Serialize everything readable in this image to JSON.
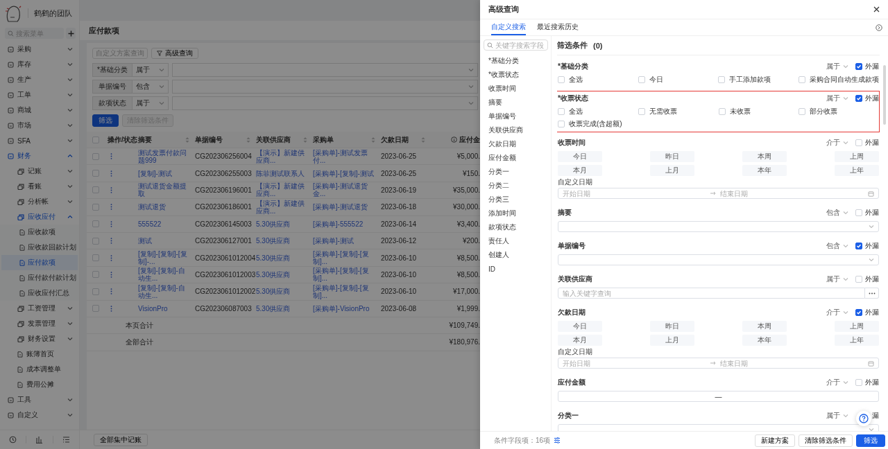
{
  "sidebar": {
    "team_name": "鹤鹤的团队",
    "search": {
      "placeholder": "搜索菜单"
    },
    "menu": [
      {
        "label": "采购",
        "expanded": false,
        "selected": false
      },
      {
        "label": "库存",
        "expanded": false,
        "selected": false
      },
      {
        "label": "生产",
        "expanded": false,
        "selected": false
      },
      {
        "label": "工单",
        "expanded": false,
        "selected": false
      },
      {
        "label": "商城",
        "expanded": false,
        "selected": false
      },
      {
        "label": "市场",
        "expanded": false,
        "selected": false
      },
      {
        "label": "SFA",
        "expanded": false,
        "selected": false
      },
      {
        "label": "财务",
        "expanded": true,
        "selected": false,
        "children": [
          {
            "label": "记账",
            "expanded": false,
            "selected": false
          },
          {
            "label": "看账",
            "expanded": false,
            "selected": false
          },
          {
            "label": "分析帐",
            "expanded": false,
            "selected": false
          },
          {
            "label": "应收应付",
            "expanded": true,
            "selected": false,
            "children": [
              {
                "label": "应收款项",
                "selected": false
              },
              {
                "label": "应收款回款计划",
                "selected": false
              },
              {
                "label": "应付款项",
                "selected": true
              },
              {
                "label": "应付款付款计划",
                "selected": false
              },
              {
                "label": "应收应付汇总",
                "selected": false
              }
            ]
          },
          {
            "label": "工资管理",
            "expanded": false,
            "selected": false
          },
          {
            "label": "发票管理",
            "expanded": false,
            "selected": false
          },
          {
            "label": "财务设置",
            "expanded": false,
            "selected": false
          },
          {
            "label": "账簿首页",
            "selected": false
          },
          {
            "label": "成本调整单",
            "selected": false
          },
          {
            "label": "费用公摊",
            "selected": false
          }
        ]
      },
      {
        "label": "工具",
        "expanded": false,
        "selected": false
      },
      {
        "label": "自定义",
        "expanded": false,
        "selected": false
      }
    ]
  },
  "page": {
    "title": "应付款项",
    "scheme_select": {
      "placeholder": "自定义方案查询"
    },
    "advanced_button": "高级查询",
    "filters": [
      {
        "label": "*基础分类",
        "operator": "属于"
      },
      {
        "label": "单据编号",
        "operator": "包含"
      },
      {
        "label": "款项状态",
        "operator": "属于"
      }
    ],
    "filter_button": "筛选",
    "clear_button": {
      "label": "清除筛选条件",
      "disabled": true
    },
    "table": {
      "all_selected": false,
      "columns": [
        {
          "label": "操作/状态"
        },
        {
          "label": "摘要",
          "sortable": true
        },
        {
          "label": "单据编号",
          "sortable": true
        },
        {
          "label": "关联供应商",
          "sortable": true
        },
        {
          "label": "采购单",
          "sortable": true
        },
        {
          "label": "欠款日期",
          "sortable": true
        },
        {
          "label": "应付金"
        }
      ],
      "rows": [
        {
          "selected": false,
          "summary": "测试发票付款问题999",
          "number": "CG202306256004",
          "supplier": "【演示】新建供应商...",
          "order": "[采购单]-测试发票付...",
          "date": "2023-06-25",
          "amount": "¥5,000."
        },
        {
          "selected": false,
          "summary": "[复制]-测试",
          "number": "CG202306255003",
          "supplier": "陈菲测试联系人",
          "order": "[采购单]-[复制]-测试",
          "date": "2023-06-25",
          "amount": "¥150."
        },
        {
          "selected": false,
          "summary": "测试退货金额提取",
          "number": "CG202306196001",
          "supplier": "【演示】新建供应商...",
          "order": "[采购单]-测试退货金...",
          "date": "2023-06-19",
          "amount": "¥35,000."
        },
        {
          "selected": false,
          "summary": "测试退货",
          "number": "CG202306186001",
          "supplier": "【演示】新建供应商...",
          "order": "[采购单]-测试退货",
          "date": "2023-06-18",
          "amount": "¥30,000."
        },
        {
          "selected": false,
          "summary": "555522",
          "number": "CG202306145003",
          "supplier": "5.30供应商",
          "order": "[采购单]-555522",
          "date": "2023-06-14",
          "amount": "¥3,400."
        },
        {
          "selected": false,
          "summary": "测试",
          "number": "CG202306127001",
          "supplier": "5.30供应商",
          "order": "[采购单]-测试",
          "date": "2023-06-12",
          "amount": "¥200."
        },
        {
          "selected": false,
          "summary": "[复制]-[复制]-[复制]-...",
          "number": "CG2023061012004",
          "supplier": "5.30供应商",
          "order": "[采购单]-[复制]-[复制]...",
          "date": "2023-06-10",
          "amount": "¥8,500."
        },
        {
          "selected": false,
          "summary": "[复制]-[复制]-自动生...",
          "number": "CG2023061012003",
          "supplier": "5.30供应商",
          "order": "[采购单]-[复制]-[复制]...",
          "date": "2023-06-10",
          "amount": "¥8,500."
        },
        {
          "selected": false,
          "summary": "[复制]-[复制]-自动生...",
          "number": "CG2023061012002",
          "supplier": "5.30供应商",
          "order": "[采购单]-[复制]-[复制]...",
          "date": "2023-06-10",
          "amount": "¥17,000."
        },
        {
          "selected": false,
          "summary": "VisionPro",
          "number": "CG202306087003",
          "supplier": "5.30供应商",
          "order": "[采购单]-VisionPro",
          "date": "2023-06-08",
          "amount": "¥1,999."
        }
      ],
      "totals": [
        {
          "label": "本页合计",
          "amount": "¥109,749."
        },
        {
          "label": "全部合计",
          "amount": "¥180,976."
        }
      ]
    },
    "bulk_button": "全部集中记账"
  },
  "drawer": {
    "title": "高级查询",
    "tabs": [
      {
        "label": "自定义搜索",
        "selected": true
      },
      {
        "label": "最近搜索历史",
        "selected": false
      }
    ],
    "field_search": {
      "placeholder": "关键字搜索字段"
    },
    "fields": [
      "*基础分类",
      "*收票状态",
      "收票时间",
      "摘要",
      "单据编号",
      "关联供应商",
      "欠款日期",
      "应付金额",
      "分类一",
      "分类二",
      "分类三",
      "添加时间",
      "款项状态",
      "责任人",
      "创建人",
      "ID"
    ],
    "conditions_title": "筛选条件",
    "conditions_count": "(0)",
    "sections": [
      {
        "label": "*基础分类",
        "operator": "属于",
        "outside": {
          "label": "外漏",
          "checked": true
        },
        "highlighted": false,
        "kind": "checkboxes",
        "options": [
          {
            "label": "全选",
            "checked": false
          },
          {
            "label": "今日",
            "checked": false
          },
          {
            "label": "手工添加款项",
            "checked": false
          },
          {
            "label": "采购合同自动生成款项",
            "checked": false
          }
        ]
      },
      {
        "label": "*收票状态",
        "operator": "属于",
        "outside": {
          "label": "外漏",
          "checked": true
        },
        "highlighted": true,
        "kind": "checkboxes",
        "options": [
          {
            "label": "全选",
            "checked": false
          },
          {
            "label": "无需收票",
            "checked": false
          },
          {
            "label": "未收票",
            "checked": false
          },
          {
            "label": "部分收票",
            "checked": false
          },
          {
            "label": "收票完成(含超额)",
            "checked": false
          }
        ]
      },
      {
        "label": "收票时间",
        "operator": "介于",
        "outside": {
          "label": "外漏",
          "checked": false
        },
        "highlighted": false,
        "kind": "dates",
        "presets": [
          "今日",
          "昨日",
          "本周",
          "上周",
          "本月",
          "上月",
          "本年",
          "上年"
        ],
        "custom_label": "自定义日期",
        "start_placeholder": "开始日期",
        "end_placeholder": "结束日期"
      },
      {
        "label": "摘要",
        "operator": "包含",
        "outside": {
          "label": "外漏",
          "checked": false
        },
        "highlighted": false,
        "kind": "select"
      },
      {
        "label": "单据编号",
        "operator": "包含",
        "outside": {
          "label": "外漏",
          "checked": true
        },
        "highlighted": false,
        "kind": "select"
      },
      {
        "label": "关联供应商",
        "operator": "属于",
        "outside": {
          "label": "外漏",
          "checked": false
        },
        "highlighted": false,
        "kind": "lookup",
        "placeholder": "输入关键字查询"
      },
      {
        "label": "欠款日期",
        "operator": "介于",
        "outside": {
          "label": "外漏",
          "checked": true
        },
        "highlighted": false,
        "kind": "dates",
        "presets": [
          "今日",
          "昨日",
          "本周",
          "上周",
          "本月",
          "上月",
          "本年",
          "上年"
        ],
        "custom_label": "自定义日期",
        "start_placeholder": "开始日期",
        "end_placeholder": "结束日期"
      },
      {
        "label": "应付金额",
        "operator": "介于",
        "outside": {
          "label": "外漏",
          "checked": false
        },
        "highlighted": false,
        "kind": "range",
        "separator": "—"
      },
      {
        "label": "分类一",
        "operator": "属于",
        "outside": {
          "label": "漏"
        },
        "highlighted": false,
        "kind": "select"
      }
    ],
    "footer": {
      "count_label": "条件字段项：16项",
      "buttons": [
        {
          "label": "新建方案",
          "kind": "default"
        },
        {
          "label": "清除筛选条件",
          "kind": "default"
        },
        {
          "label": "筛选",
          "kind": "primary"
        }
      ]
    }
  }
}
